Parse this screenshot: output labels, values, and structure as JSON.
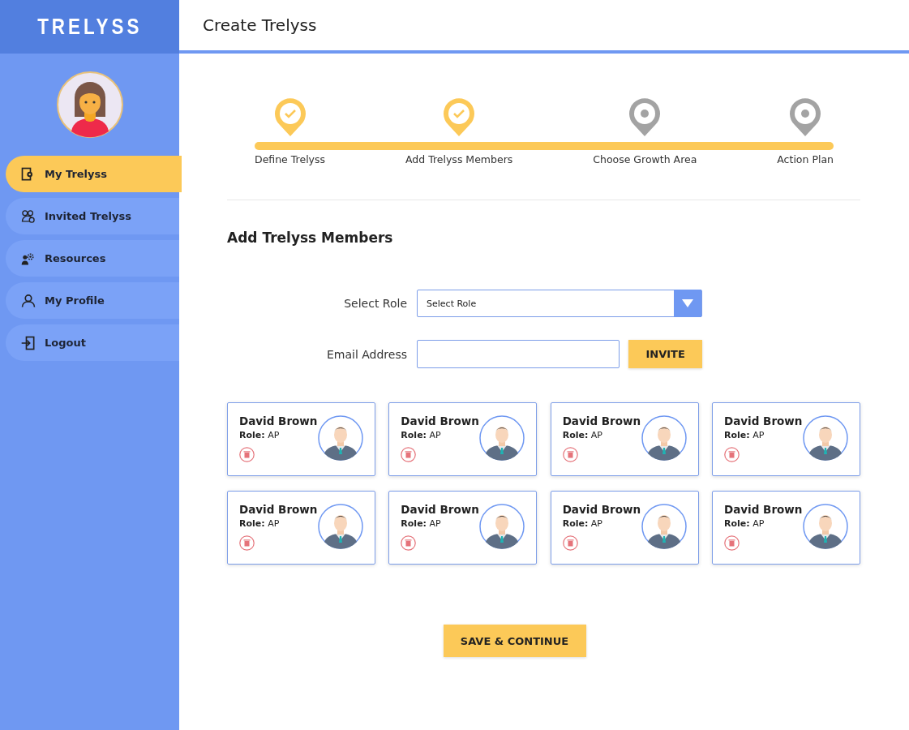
{
  "brand": "TRELYSS",
  "header": {
    "title": "Create Trelyss"
  },
  "sidebar": {
    "items": [
      {
        "label": "My Trelyss",
        "selected": true
      },
      {
        "label": "Invited Trelyss",
        "selected": false
      },
      {
        "label": "Resources",
        "selected": false
      },
      {
        "label": "My Profile",
        "selected": false
      },
      {
        "label": "Logout",
        "selected": false
      }
    ]
  },
  "steps": [
    {
      "label": "Define Trelyss",
      "completed": true
    },
    {
      "label": "Add Trelyss Members",
      "completed": true
    },
    {
      "label": "Choose Growth Area",
      "completed": false
    },
    {
      "label": "Action Plan",
      "completed": false
    }
  ],
  "section_title": "Add Trelyss Members",
  "form": {
    "role_label": "Select Role",
    "role_value": "Select Role",
    "email_label": "Email Address",
    "invite_button": "INVITE"
  },
  "members": [
    {
      "name": "David Brown",
      "role": "**Role:** AP"
    },
    {
      "name": "David Brown",
      "role": "**Role:** AP"
    },
    {
      "name": "David Brown",
      "role": "**Role:** AP"
    },
    {
      "name": "David Brown",
      "role": "**Role:** AP"
    },
    {
      "name": "David Brown",
      "role": "**Role:** AP"
    },
    {
      "name": "David Brown",
      "role": "**Role:** AP"
    },
    {
      "name": "David Brown",
      "role": "**Role:** AP"
    },
    {
      "name": "David Brown",
      "role": "**Role:** AP"
    }
  ],
  "save_button": "SAVE & CONTINUE"
}
